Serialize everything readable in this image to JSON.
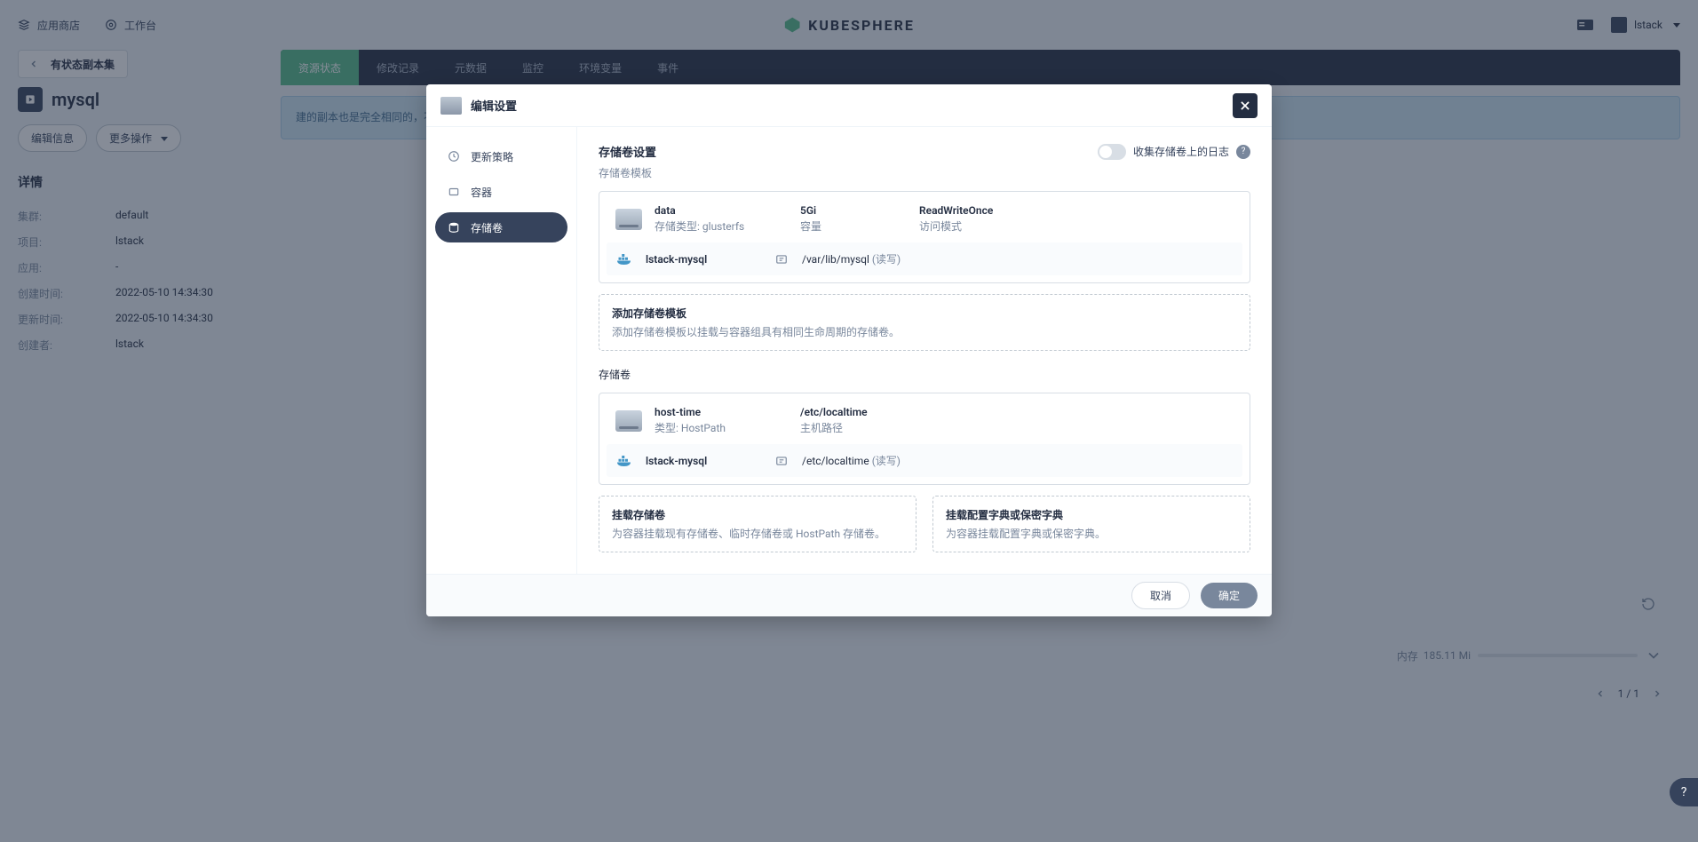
{
  "topbar": {
    "app_store": "应用商店",
    "workbench": "工作台",
    "logo_text": "KUBESPHERE",
    "user": "lstack"
  },
  "breadcrumb": "有状态副本集",
  "page_title": "mysql",
  "buttons": {
    "edit_info": "编辑信息",
    "more_ops": "更多操作"
  },
  "details": {
    "heading": "详情",
    "rows": {
      "cluster_k": "集群:",
      "cluster_v": "default",
      "project_k": "项目:",
      "project_v": "lstack",
      "app_k": "应用:",
      "app_v": "-",
      "created_k": "创建时间:",
      "created_v": "2022-05-10 14:34:30",
      "updated_k": "更新时间:",
      "updated_v": "2022-05-10 14:34:30",
      "creator_k": "创建者:",
      "creator_v": "lstack"
    }
  },
  "tabs": [
    "资源状态",
    "修改记录",
    "元数据",
    "监控",
    "环境变量",
    "事件"
  ],
  "info_strip": "建的副本也是完全相同的，不同的是每个副本有个固定且唯一",
  "memory": {
    "label": "内存",
    "value": "185.11 Mi"
  },
  "pager": {
    "text": "1 / 1"
  },
  "modal": {
    "title": "编辑设置",
    "nav": {
      "update": "更新策略",
      "container": "容器",
      "volume": "存储卷"
    },
    "section1_title": "存储卷设置",
    "toggle_label": "收集存储卷上的日志",
    "sub_template": "存储卷模板",
    "vol1": {
      "name": "data",
      "type_k": "存储类型:",
      "type_v": "glusterfs",
      "cap_v": "5Gi",
      "cap_k": "容量",
      "mode_v": "ReadWriteOnce",
      "mode_k": "访问模式",
      "mount_name": "lstack-mysql",
      "mount_path": "/var/lib/mysql",
      "mount_mode": "(读写)"
    },
    "add_template": {
      "t1": "添加存储卷模板",
      "t2": "添加存储卷模板以挂载与容器组具有相同生命周期的存储卷。"
    },
    "sub_volumes": "存储卷",
    "vol2": {
      "name": "host-time",
      "type_k": "类型:",
      "type_v": "HostPath",
      "path_v": "/etc/localtime",
      "path_k": "主机路径",
      "mount_name": "lstack-mysql",
      "mount_path": "/etc/localtime",
      "mount_mode": "(读写)"
    },
    "card_mount": {
      "t1": "挂载存储卷",
      "t2": "为容器挂载现有存储卷、临时存储卷或 HostPath 存储卷。"
    },
    "card_config": {
      "t1": "挂载配置字典或保密字典",
      "t2": "为容器挂载配置字典或保密字典。"
    },
    "footer": {
      "cancel": "取消",
      "ok": "确定"
    }
  }
}
